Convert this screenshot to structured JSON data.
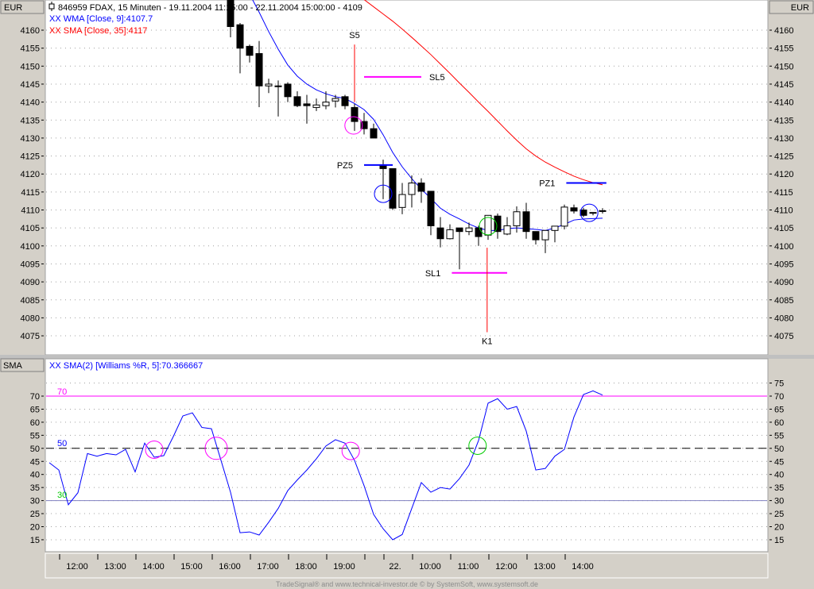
{
  "header": {
    "title": "846959  FDAX, 15 Minuten - 19.11.2004 11:15:00 - 22.11.2004 15:00:00 - 4109",
    "legend_wma": "XX WMA [Close, 9]:4107.7",
    "legend_sma": "XX SMA [Close, 35]:4117",
    "currency_left": "EUR",
    "currency_right": "EUR"
  },
  "indicator_panel": {
    "label": "SMA",
    "legend": "XX SMA(2) [Williams %R, 5]:70.366667",
    "level_70": "70",
    "level_50": "50",
    "level_30": "30"
  },
  "footer": "TradeSignal® and www.technical-investor.de © by SystemSoft, www.systemsoft.de",
  "colors": {
    "wma": "#0000ff",
    "sma": "#ff0000",
    "magenta": "#ff00ff",
    "green": "#00cc00",
    "blue": "#0000ff",
    "red": "#ff0000"
  },
  "chart_data": [
    {
      "type": "candlestick",
      "title": "FDAX 15 Minuten",
      "ylabel": "EUR",
      "ylim": [
        4072,
        4168
      ],
      "yticks": [
        4160,
        4155,
        4150,
        4145,
        4140,
        4135,
        4130,
        4125,
        4120,
        4115,
        4110,
        4105,
        4100,
        4095,
        4090,
        4085,
        4080,
        4075
      ],
      "grid": true,
      "first_bar": 19,
      "ohlc": [
        [
          4175,
          4180,
          4158,
          4161
        ],
        [
          4161.5,
          4162,
          4148,
          4155
        ],
        [
          4155.5,
          4156,
          4151,
          4153
        ],
        [
          4153.5,
          4157,
          4138.6,
          4144.5
        ],
        [
          4144.5,
          4146.5,
          4142.5,
          4145
        ],
        [
          4144.5,
          4146,
          4136,
          4144.5
        ],
        [
          4145,
          4145.5,
          4140,
          4141.5
        ],
        [
          4141.5,
          4143,
          4138.6,
          4139
        ],
        [
          4139.5,
          4142,
          4134,
          4139
        ],
        [
          4138.5,
          4141,
          4137.5,
          4139.2
        ],
        [
          4139,
          4143,
          4138,
          4140
        ],
        [
          4140.3,
          4142,
          4138.5,
          4141
        ],
        [
          4141.5,
          4142,
          4138,
          4139
        ],
        [
          4138.5,
          4139.5,
          4132,
          4134.6
        ],
        [
          4134.6,
          4137,
          4131,
          4132.6
        ],
        [
          4132.6,
          4134,
          4130,
          4130
        ],
        [
          4122.5,
          4124,
          4113,
          4121.5
        ],
        [
          4121.5,
          4121.5,
          4110,
          4110.5
        ],
        [
          4110.7,
          4117.5,
          4108.8,
          4114.3
        ],
        [
          4114.3,
          4119.6,
          4110.7,
          4117.5
        ],
        [
          4117.5,
          4118.8,
          4112,
          4115.2
        ],
        [
          4115.2,
          4115.2,
          4103,
          4105.6
        ],
        [
          4105,
          4108,
          4099.6,
          4102
        ],
        [
          4102,
          4106,
          4101.8,
          4104.5
        ],
        [
          4105,
          4105,
          4093.5,
          4104
        ],
        [
          4104,
          4106.5,
          4103,
          4105
        ],
        [
          4105,
          4105.6,
          4100,
          4102.6
        ],
        [
          4103,
          4108.5,
          4101.7,
          4108.5
        ],
        [
          4108.3,
          4109,
          4102,
          4104
        ],
        [
          4103.3,
          4108,
          4103,
          4105.6
        ],
        [
          4105.6,
          4111,
          4103.7,
          4109.5
        ],
        [
          4109.5,
          4112,
          4102,
          4104
        ],
        [
          4104,
          4104,
          4100.4,
          4101.7
        ],
        [
          4101.7,
          4104.3,
          4098,
          4104.3
        ],
        [
          4104.3,
          4105.5,
          4101,
          4105.5
        ],
        [
          4105.5,
          4111.5,
          4104.6,
          4110.8
        ],
        [
          4110.6,
          4111.5,
          4109,
          4109.7
        ],
        [
          4110,
          4110.6,
          4108,
          4108.5
        ],
        [
          4109.3,
          4109.3,
          4108.5,
          4109.3
        ],
        [
          4109.8,
          4110.5,
          4109,
          4109.8
        ]
      ],
      "wma": {
        "name": "WMA [Close, 9]",
        "first_bar": 21,
        "values": [
          4170,
          4165,
          4159.6,
          4154.7,
          4150.3,
          4147.2,
          4145,
          4143.4,
          4142.3,
          4141.5,
          4141,
          4139.6,
          4137.9,
          4135.2,
          4130.9,
          4126,
          4122,
          4118.7,
          4115.8,
          4113.2,
          4110.5,
          4108.8,
          4107.5,
          4106.1,
          4105,
          4104.3,
          4104.3,
          4104.8,
          4105,
          4104.8,
          4104.6,
          4104.3,
          4105,
          4106,
          4107.2,
          4107.5,
          4107.6,
          4107.7
        ]
      },
      "sma": {
        "name": "SMA [Close, 35]",
        "first_bar": 33,
        "values": [
          4168.5,
          4166.5,
          4164.5,
          4162.5,
          4160.3,
          4158,
          4155.6,
          4153.2,
          4150.6,
          4148,
          4145.3,
          4142.7,
          4140,
          4137.4,
          4134.7,
          4132,
          4129.4,
          4127,
          4125,
          4123.3,
          4121.9,
          4120.6,
          4119.4,
          4118.4,
          4117.6,
          4117
        ]
      },
      "annotations": {
        "hlines": [
          {
            "label": "SL5",
            "price": 4147,
            "bar_from": 33,
            "bar_to": 39,
            "color": "#ff00ff"
          },
          {
            "label": "PZ5",
            "price": 4122.5,
            "bar_from": 33,
            "bar_to": 36,
            "color": "#0000ff"
          },
          {
            "label": "PZ1",
            "price": 4117.5,
            "bar_from": 54.2,
            "bar_to": 58.4,
            "color": "#0000ff"
          },
          {
            "label": "SL1",
            "price": 4092.5,
            "bar_from": 42.2,
            "bar_to": 48,
            "color": "#ff00ff"
          }
        ],
        "vlines": [
          {
            "label": "S5",
            "bar": 32,
            "price_from": 4156,
            "price_to": 4140,
            "color": "#ff0000"
          },
          {
            "label": "K1",
            "bar": 45.9,
            "price_from": 4099.5,
            "price_to": 4076,
            "color": "#ff0000"
          }
        ],
        "circles": [
          {
            "bar": 31.9,
            "price": 4133.5,
            "color": "#ff00ff"
          },
          {
            "bar": 35,
            "price": 4114.5,
            "color": "#0000ff"
          },
          {
            "bar": 46,
            "price": 4105.5,
            "color": "#00cc00"
          },
          {
            "bar": 56.6,
            "price": 4109.2,
            "color": "#0000ff"
          }
        ]
      }
    },
    {
      "type": "line",
      "title": "SMA(2) [Williams %R, 5]",
      "ylim": [
        12,
        78
      ],
      "yticks_left": [
        70,
        65,
        60,
        55,
        50,
        45,
        40,
        35,
        30,
        25,
        20,
        15
      ],
      "yticks_right": [
        75,
        70,
        65,
        60,
        55,
        50,
        45,
        40,
        35,
        30,
        25,
        20,
        15
      ],
      "levels": [
        70,
        50,
        30
      ],
      "values": [
        44.5,
        41.7,
        28.4,
        33,
        48,
        47,
        48,
        47.5,
        49.6,
        41,
        52,
        46.6,
        47.2,
        54.5,
        62.4,
        63.6,
        58,
        57.5,
        45.4,
        33.2,
        17.7,
        18,
        16.8,
        21.7,
        27,
        33.8,
        37.9,
        41.7,
        46,
        50.9,
        53.3,
        52,
        45.4,
        35.7,
        24.7,
        19.2,
        15,
        17,
        27,
        36.9,
        33.2,
        35,
        34.4,
        38.4,
        43.6,
        53,
        67.3,
        69,
        65,
        66,
        56.6,
        41.7,
        42.3,
        47,
        49.6,
        62,
        70.6,
        72,
        70.4
      ],
      "circles": [
        {
          "bar": 11,
          "value": 49.5,
          "color": "#ff00ff"
        },
        {
          "bar": 17.5,
          "value": 50,
          "color": "#ff00ff"
        },
        {
          "bar": 31.6,
          "value": 49,
          "color": "#ff00ff"
        },
        {
          "bar": 44.9,
          "value": 51,
          "color": "#00cc00"
        }
      ]
    }
  ],
  "x_ticks": [
    {
      "bar": 1,
      "label": "12:00"
    },
    {
      "bar": 5,
      "label": "13:00"
    },
    {
      "bar": 9,
      "label": "14:00"
    },
    {
      "bar": 13,
      "label": "15:00"
    },
    {
      "bar": 17,
      "label": "16:00"
    },
    {
      "bar": 21,
      "label": "17:00"
    },
    {
      "bar": 25,
      "label": "18:00"
    },
    {
      "bar": 29,
      "label": "19:00"
    },
    {
      "bar": 33,
      "label": ""
    },
    {
      "bar": 35,
      "label": "22."
    },
    {
      "bar": 38,
      "label": "10:00"
    },
    {
      "bar": 42,
      "label": "11:00"
    },
    {
      "bar": 46,
      "label": "12:00"
    },
    {
      "bar": 50,
      "label": "13:00"
    },
    {
      "bar": 54,
      "label": "14:00"
    }
  ]
}
